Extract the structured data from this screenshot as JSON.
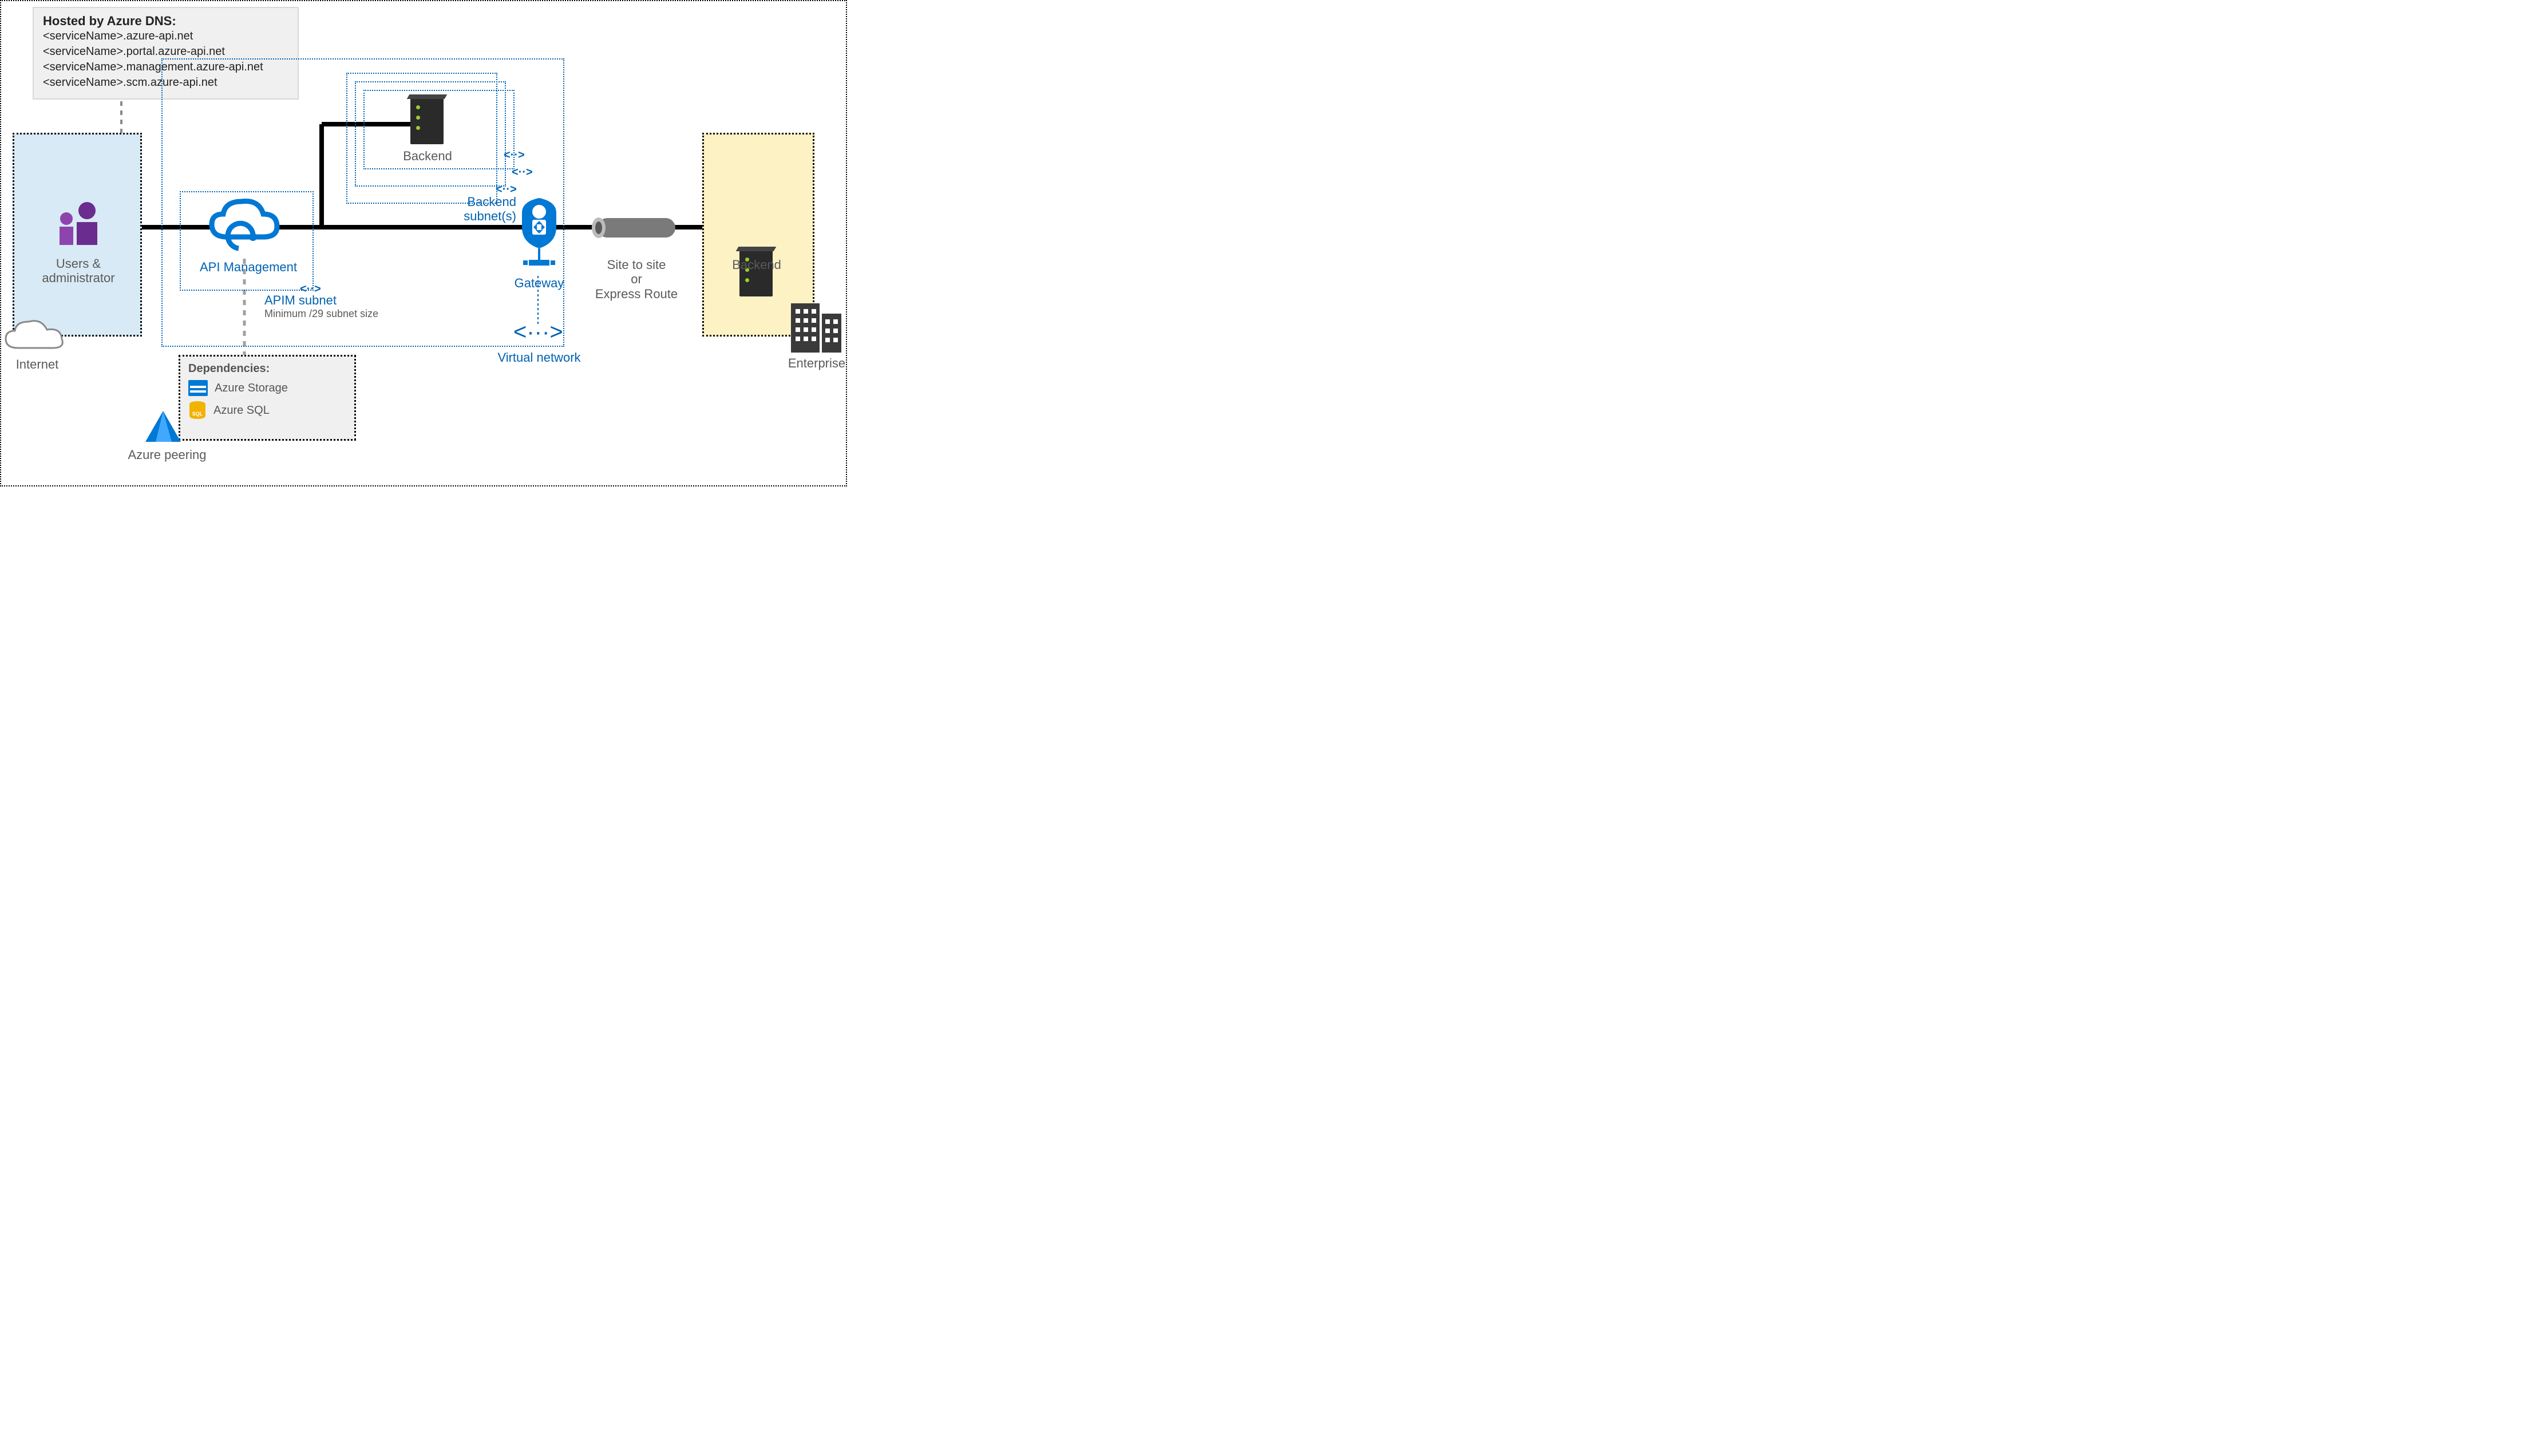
{
  "dns": {
    "title": "Hosted by Azure DNS:",
    "lines": [
      "<serviceName>.azure-api.net",
      "<serviceName>.portal.azure-api.net",
      "<serviceName>.management.azure-api.net",
      "<serviceName>.scm.azure-api.net"
    ]
  },
  "users": {
    "label": "Users &\nadministrator"
  },
  "internet": {
    "label": "Internet"
  },
  "apim": {
    "label": "API Management"
  },
  "apim_subnet": {
    "title": "APIM subnet",
    "note": "Minimum /29 subnet size"
  },
  "backend_subnets": {
    "label": "Backend\nsubnet(s)"
  },
  "backend_top": {
    "label": "Backend"
  },
  "gateway": {
    "label": "Gateway"
  },
  "vnet": {
    "label": "Virtual network"
  },
  "tunnel": {
    "label": "Site to site\nor\nExpress Route"
  },
  "backend_ent": {
    "label": "Backend"
  },
  "enterprise": {
    "label": "Enterprise"
  },
  "dependencies": {
    "title": "Dependencies:",
    "storage": "Azure Storage",
    "sql": "Azure SQL"
  },
  "peering": {
    "label": "Azure peering"
  }
}
